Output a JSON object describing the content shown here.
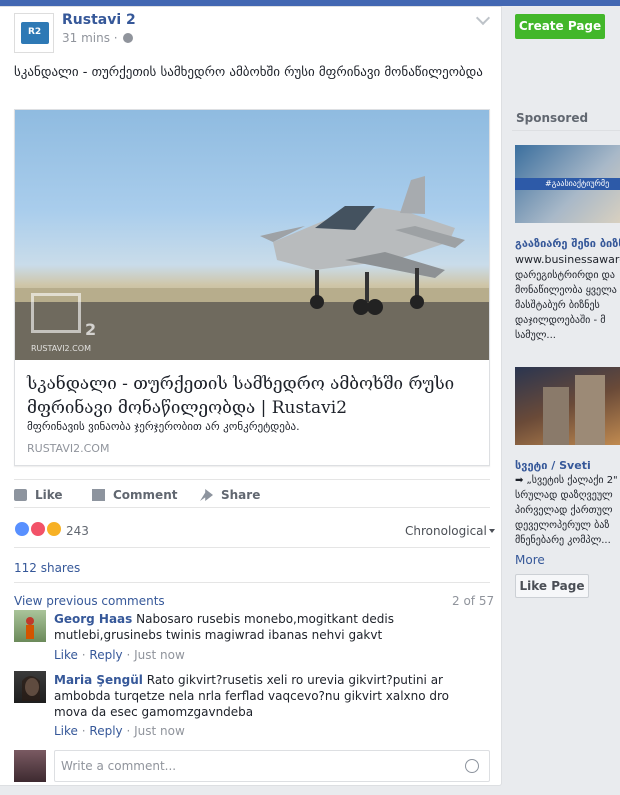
{
  "post": {
    "page_name": "Rustavi 2",
    "page_logo_text": "R2",
    "time": "31 mins",
    "text": "სკანდალი - თურქეთის სამხედრო ამბოხში რუსი მფრინავი მონაწილეობდა",
    "link": {
      "title": "სკანდალი - თურქეთის სამხედრო ამბოხში რუსი მფრინავი მონაწილეობდა | Rustavi2",
      "description": "მფრინავის ვინაობა ჯერჯერობით არ კონკრეტდება.",
      "domain": "RUSTAVI2.COM",
      "watermark": "RUSTAVI2.COM",
      "watermark_digit": "2"
    },
    "actions": {
      "like": "Like",
      "comment": "Comment",
      "share": "Share"
    },
    "reactions": {
      "count": "243",
      "sort": "Chronological"
    },
    "shares": "112 shares",
    "comments": {
      "view_previous": "View previous comments",
      "count": "2 of 57",
      "items": [
        {
          "name": "Georg Haas",
          "text": "Nabosaro rusebis monebo,mogitkant dedis mutlebi,grusinebs twinis magiwrad ibanas nehvi gakvt",
          "like": "Like",
          "reply": "Reply",
          "time": "Just now"
        },
        {
          "name": "Maria Şengül",
          "text": "Rato gikvirt?rusetis xeli ro urevia gikvirt?putini ar ambobda turqetze nela nrla ferflad vaqcevo?nu gikvirt xalxno dro mova da esec gamomzgavndeba",
          "like": "Like",
          "reply": "Reply",
          "time": "Just now"
        }
      ],
      "input_placeholder": "Write a comment..."
    }
  },
  "sidebar": {
    "create_page": "Create Page",
    "sponsored": "Sponsored",
    "ad1": {
      "banner": "#გაასიაქტიურმე",
      "title": "გააზიარე შენი ბიზნ",
      "url": "www.businessaward.g",
      "body": "დარეგისტრირდი და\nმონაწილეობა ყველა\nმასშტაბურ ბიზნეს\nდაჯილდოებაში - მ\nსამულ..."
    },
    "ad2": {
      "title": "სვეტი / Sveti",
      "body": "➡ „სვეტის ქალაქი 2\"\nსრულად დაზღვეულ\nპირველად ქართულ\nდეველოპერულ ბაზ\nმნენებარე კომპლ...",
      "more": "More"
    },
    "like_page": "Like Page"
  },
  "colors": {
    "facebook_blue": "#4267b2",
    "link_blue": "#365899",
    "green_button": "#42b72a",
    "background": "#e9ebee"
  }
}
